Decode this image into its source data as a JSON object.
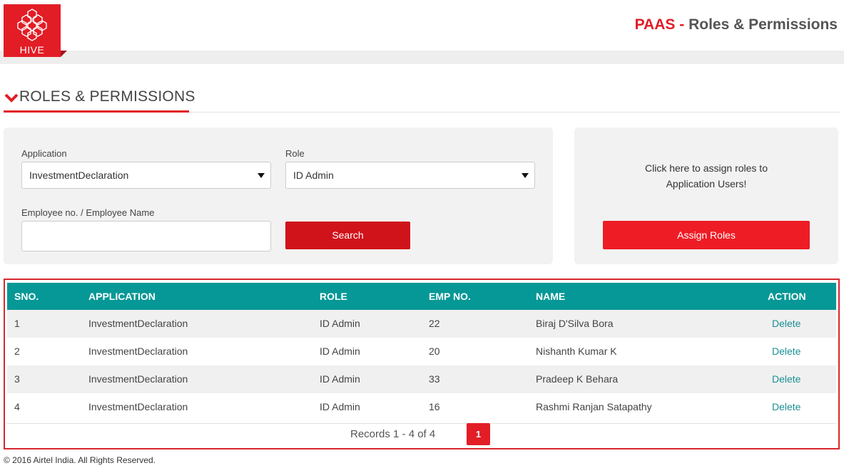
{
  "header": {
    "logo_text": "HIVE",
    "title_brand": "PAAS",
    "title_sep": " - ",
    "title_rest": "Roles & Permissions"
  },
  "section": {
    "title": "ROLES & PERMISSIONS"
  },
  "filters": {
    "application_label": "Application",
    "application_value": "InvestmentDeclaration",
    "role_label": "Role",
    "role_value": "ID Admin",
    "employee_label": "Employee no. / Employee Name",
    "employee_value": "",
    "search_label": "Search"
  },
  "assign": {
    "text_line1": "Click here to assign roles to",
    "text_line2": "Application Users!",
    "button_label": "Assign Roles"
  },
  "table": {
    "headers": [
      "SNO.",
      "APPLICATION",
      "ROLE",
      "EMP NO.",
      "NAME",
      "ACTION"
    ],
    "rows": [
      {
        "sno": "1",
        "application": "InvestmentDeclaration",
        "role": "ID Admin",
        "emp_no": "22",
        "name": "Biraj D'Silva Bora",
        "action": "Delete"
      },
      {
        "sno": "2",
        "application": "InvestmentDeclaration",
        "role": "ID Admin",
        "emp_no": "20",
        "name": "Nishanth Kumar K",
        "action": "Delete"
      },
      {
        "sno": "3",
        "application": "InvestmentDeclaration",
        "role": "ID Admin",
        "emp_no": "33",
        "name": "Pradeep K Behara",
        "action": "Delete"
      },
      {
        "sno": "4",
        "application": "InvestmentDeclaration",
        "role": "ID Admin",
        "emp_no": "16",
        "name": "Rashmi Ranjan Satapathy",
        "action": "Delete"
      }
    ],
    "records_text": "Records 1 - 4 of 4",
    "current_page": "1"
  },
  "footer": {
    "text": "© 2016 Airtel India. All Rights Reserved."
  },
  "colors": {
    "brand_red": "#e21d26",
    "table_header": "#069896",
    "link": "#1a8f95"
  }
}
